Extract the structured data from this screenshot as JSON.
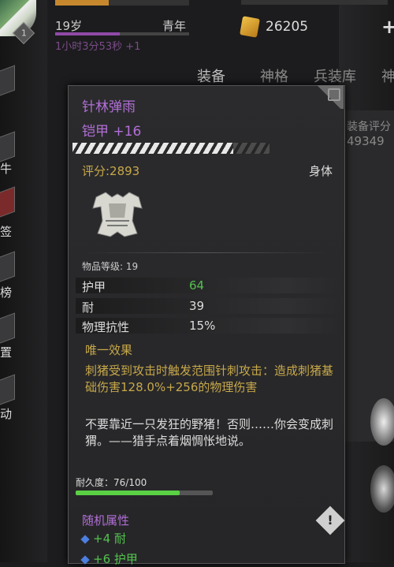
{
  "header": {
    "level": "1",
    "age": "19岁",
    "stage": "青年",
    "timer": "1小时3分53秒 +1",
    "gold": "26205",
    "add": "+"
  },
  "sidebar_fragments": [
    "牛",
    "签",
    "榜",
    "置",
    "动"
  ],
  "tabs": [
    {
      "label": "装备",
      "active": true
    },
    {
      "label": "神格",
      "active": false
    },
    {
      "label": "兵装库",
      "active": false
    },
    {
      "label": "神",
      "active": false
    }
  ],
  "behind": {
    "label": "装备评分",
    "value": "49349"
  },
  "item": {
    "name": "针林弹雨",
    "type": "铠甲 +16",
    "stars_filled": 0.83,
    "score": "评分:2893",
    "slot": "身体",
    "item_level": "物品等级: 19",
    "stats": [
      {
        "name": "护甲",
        "value": "64",
        "color": "#53c24e"
      },
      {
        "name": "耐",
        "value": "39"
      },
      {
        "name": "物理抗性",
        "value": "15%"
      }
    ],
    "unique_title": "唯一效果",
    "unique_desc": "刺猪受到攻击时触发范围针刺攻击：造成刺猪基础伤害128.0%+256的物理伤害",
    "flavor": "不要靠近一只发狂的野猪！否则……你会变成刺猬。——猎手点着烟惆怅地说。",
    "durability_label": "耐久度：76/100",
    "durability": 0.76,
    "random_title": "随机属性",
    "random_attrs": [
      "+4 耐",
      "+6 护甲"
    ]
  }
}
